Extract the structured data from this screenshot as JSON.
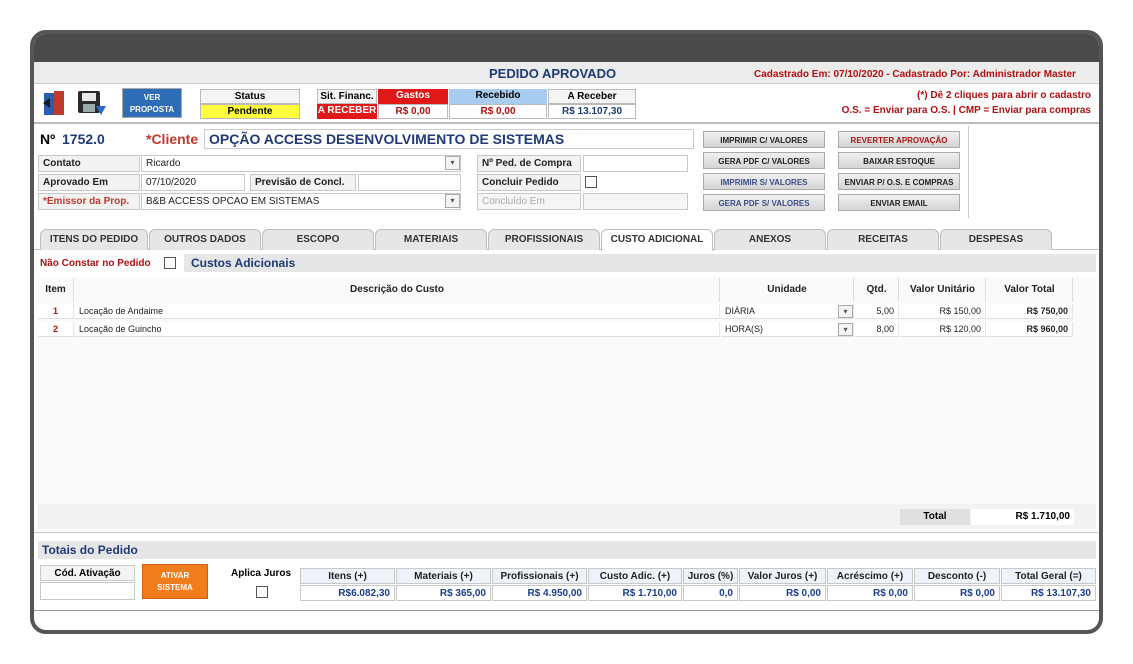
{
  "header": {
    "title": "PEDIDO APROVADO",
    "created": "Cadastrado Em: 07/10/2020 - Cadastrado Por: Administrador Master",
    "hint1": "(*) Dê 2 cliques para abrir o cadastro",
    "hint2": "O.S. = Enviar para O.S. | CMP = Enviar para compras"
  },
  "toolbar": {
    "ver_proposta": "VER PROPOSTA",
    "status_label": "Status",
    "status_value": "Pendente",
    "sit_label": "Sit. Financ.",
    "sit_value": "A RECEBER",
    "gastos_label": "Gastos",
    "gastos_value": "R$ 0,00",
    "recebido_label": "Recebido",
    "recebido_value": "R$ 0,00",
    "areceber_label": "A Receber",
    "areceber_value": "R$ 13.107,30"
  },
  "order": {
    "num_label": "Nº",
    "num_value": "1752.0",
    "cliente_label": "*Cliente",
    "cliente_value": "OPÇÃO ACCESS DESENVOLVIMENTO DE SISTEMAS",
    "contato_label": "Contato",
    "contato_value": "Ricardo",
    "aprovado_label": "Aprovado Em",
    "aprovado_value": "07/10/2020",
    "previsao_label": "Previsão de Concl.",
    "previsao_value": "",
    "emissor_label": "*Emissor da Prop.",
    "emissor_value": "B&B ACCESS OPCAO EM SISTEMAS",
    "pedcompra_label": "Nº Ped. de Compra",
    "pedcompra_value": "",
    "concluir_label": "Concluir Pedido",
    "concluido_placeholder": "Concluído Em"
  },
  "actions": {
    "imprimir_com": "IMPRIMIR C/ VALORES",
    "pdf_com": "GERA PDF C/ VALORES",
    "imprimir_sem": "IMPRIMIR S/ VALORES",
    "pdf_sem": "GERA PDF S/ VALORES",
    "reverter": "REVERTER APROVAÇÃO",
    "baixar": "BAIXAR ESTOQUE",
    "enviar_os": "ENVIAR P/ O.S. E COMPRAS",
    "enviar_email": "ENVIAR EMAIL"
  },
  "tabs": [
    "ITENS DO PEDIDO",
    "OUTROS DADOS",
    "ESCOPO",
    "MATERIAIS",
    "PROFISSIONAIS",
    "CUSTO ADICIONAL",
    "ANEXOS",
    "RECEITAS",
    "DESPESAS"
  ],
  "section": {
    "nao_constar": "Não Constar no Pedido",
    "title": "Custos Adicionais"
  },
  "table": {
    "headers": {
      "item": "Item",
      "desc": "Descrição do Custo",
      "unidade": "Unidade",
      "qtd": "Qtd.",
      "unit": "Valor Unitário",
      "total": "Valor Total"
    },
    "rows": [
      {
        "item": "1",
        "desc": "Locação de Andaime",
        "unidade": "DIÁRIA",
        "qtd": "5,00",
        "unit": "R$ 150,00",
        "total": "R$ 750,00"
      },
      {
        "item": "2",
        "desc": "Locação de Guincho",
        "unidade": "HORA(S)",
        "qtd": "8,00",
        "unit": "R$ 120,00",
        "total": "R$ 960,00"
      }
    ],
    "total_label": "Total",
    "total_value": "R$ 1.710,00"
  },
  "totals": {
    "title": "Totais do Pedido",
    "cod_ativacao": "Cód. Ativação",
    "ativar": "ATIVAR SISTEMA",
    "aplica_juros": "Aplica Juros",
    "itens_label": "Itens (+)",
    "itens_value": "R$6.082,30",
    "materiais_label": "Materiais (+)",
    "materiais_value": "R$ 365,00",
    "prof_label": "Profissionais (+)",
    "prof_value": "R$ 4.950,00",
    "custo_label": "Custo Adic. (+)",
    "custo_value": "R$ 1.710,00",
    "juros_label": "Juros (%)",
    "juros_value": "0,0",
    "vjuros_label": "Valor Juros (+)",
    "vjuros_value": "R$ 0,00",
    "acres_label": "Acréscimo (+)",
    "acres_value": "R$ 0,00",
    "desc_label": "Desconto (-)",
    "desc_value": "R$ 0,00",
    "geral_label": "Total Geral (=)",
    "geral_value": "R$ 13.107,30"
  }
}
